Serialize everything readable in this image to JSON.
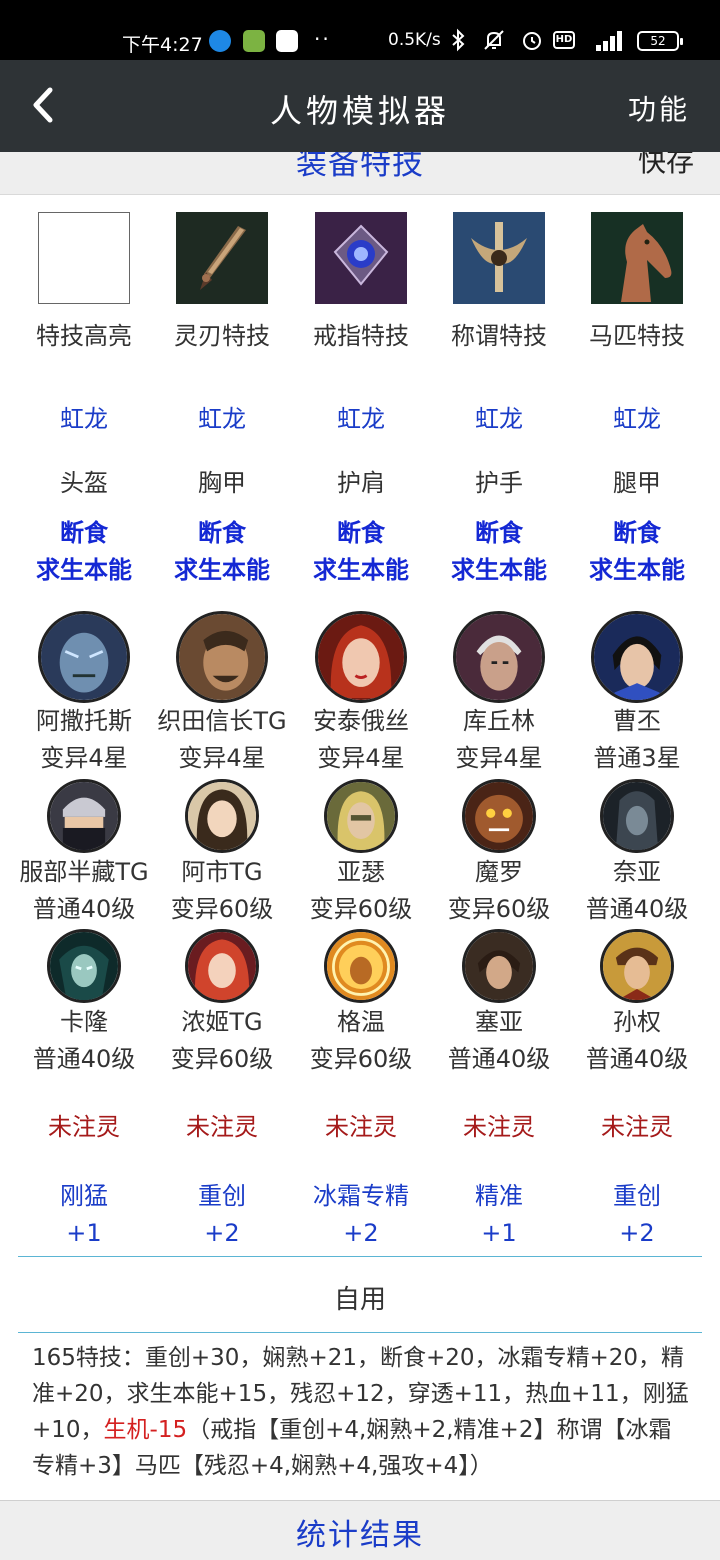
{
  "status_bar": {
    "time": "下午4:27",
    "dots": "··",
    "net_speed": "0.5K/s",
    "battery": "52",
    "hd_label": "HD",
    "icons": [
      "k-app-icon",
      "download-app-icon",
      "cloud-app-icon",
      "bluetooth-icon",
      "mute-icon",
      "alarm-icon",
      "hd-icon",
      "signal-4g-icon",
      "battery-icon"
    ]
  },
  "header": {
    "title": "人物模拟器",
    "function_label": "功能",
    "back_icon": "back-arrow-icon"
  },
  "substrip": {
    "title": "装备特技",
    "save_label": "快存"
  },
  "special_skills": [
    {
      "label": "特技高亮",
      "icon": "blank-slot"
    },
    {
      "label": "灵刃特技",
      "icon": "dagger-icon"
    },
    {
      "label": "戒指特技",
      "icon": "ring-icon"
    },
    {
      "label": "称谓特技",
      "icon": "emblem-icon"
    },
    {
      "label": "马匹特技",
      "icon": "horse-icon"
    }
  ],
  "equipment": [
    {
      "set": "虹龙",
      "slot": "头盔",
      "skill1": "断食",
      "skill2": "求生本能"
    },
    {
      "set": "虹龙",
      "slot": "胸甲",
      "skill1": "断食",
      "skill2": "求生本能"
    },
    {
      "set": "虹龙",
      "slot": "护肩",
      "skill1": "断食",
      "skill2": "求生本能"
    },
    {
      "set": "虹龙",
      "slot": "护手",
      "skill1": "断食",
      "skill2": "求生本能"
    },
    {
      "set": "虹龙",
      "slot": "腿甲",
      "skill1": "断食",
      "skill2": "求生本能"
    }
  ],
  "heroes_main": [
    {
      "name": "阿撒托斯",
      "level": "变异4星"
    },
    {
      "name": "织田信长TG",
      "level": "变异4星"
    },
    {
      "name": "安泰俄丝",
      "level": "变异4星"
    },
    {
      "name": "库丘林",
      "level": "变异4星"
    },
    {
      "name": "曹丕",
      "level": "普通3星"
    }
  ],
  "heroes_row2": [
    {
      "name": "服部半藏TG",
      "level": "普通40级"
    },
    {
      "name": "阿市TG",
      "level": "变异60级"
    },
    {
      "name": "亚瑟",
      "level": "变异60级"
    },
    {
      "name": "魔罗",
      "level": "变异60级"
    },
    {
      "name": "奈亚",
      "level": "普通40级"
    }
  ],
  "heroes_row3": [
    {
      "name": "卡隆",
      "level": "普通40级"
    },
    {
      "name": "浓姬TG",
      "level": "变异60级"
    },
    {
      "name": "格温",
      "level": "变异60级"
    },
    {
      "name": "塞亚",
      "level": "普通40级"
    },
    {
      "name": "孙权",
      "level": "普通40级"
    }
  ],
  "spirit": [
    "未注灵",
    "未注灵",
    "未注灵",
    "未注灵",
    "未注灵"
  ],
  "bonuses": [
    {
      "name": "刚猛",
      "value": "+1"
    },
    {
      "name": "重创",
      "value": "+2"
    },
    {
      "name": "冰霜专精",
      "value": "+2"
    },
    {
      "name": "精准",
      "value": "+1"
    },
    {
      "name": "重创",
      "value": "+2"
    }
  ],
  "self_use_label": "自用",
  "summary": {
    "part1": "165特技：重创+30，娴熟+21，断食+20，冰霜专精+20，精准+20，求生本能+15，残忍+12，穿透+11，热血+11，刚猛+10，",
    "red": "生机-15",
    "part2": "（戒指【重创+4,娴熟+2,精准+2】称谓【冰霜专精+3】马匹【残忍+4,娴熟+4,强攻+4】）"
  },
  "stats_button": "统计结果",
  "colors": {
    "header_bg": "#2e3336",
    "accent_blue": "#1a3cc8",
    "spirit_red": "#a51a1a",
    "warning_red": "#d42020",
    "divider": "#5bb5d4"
  }
}
